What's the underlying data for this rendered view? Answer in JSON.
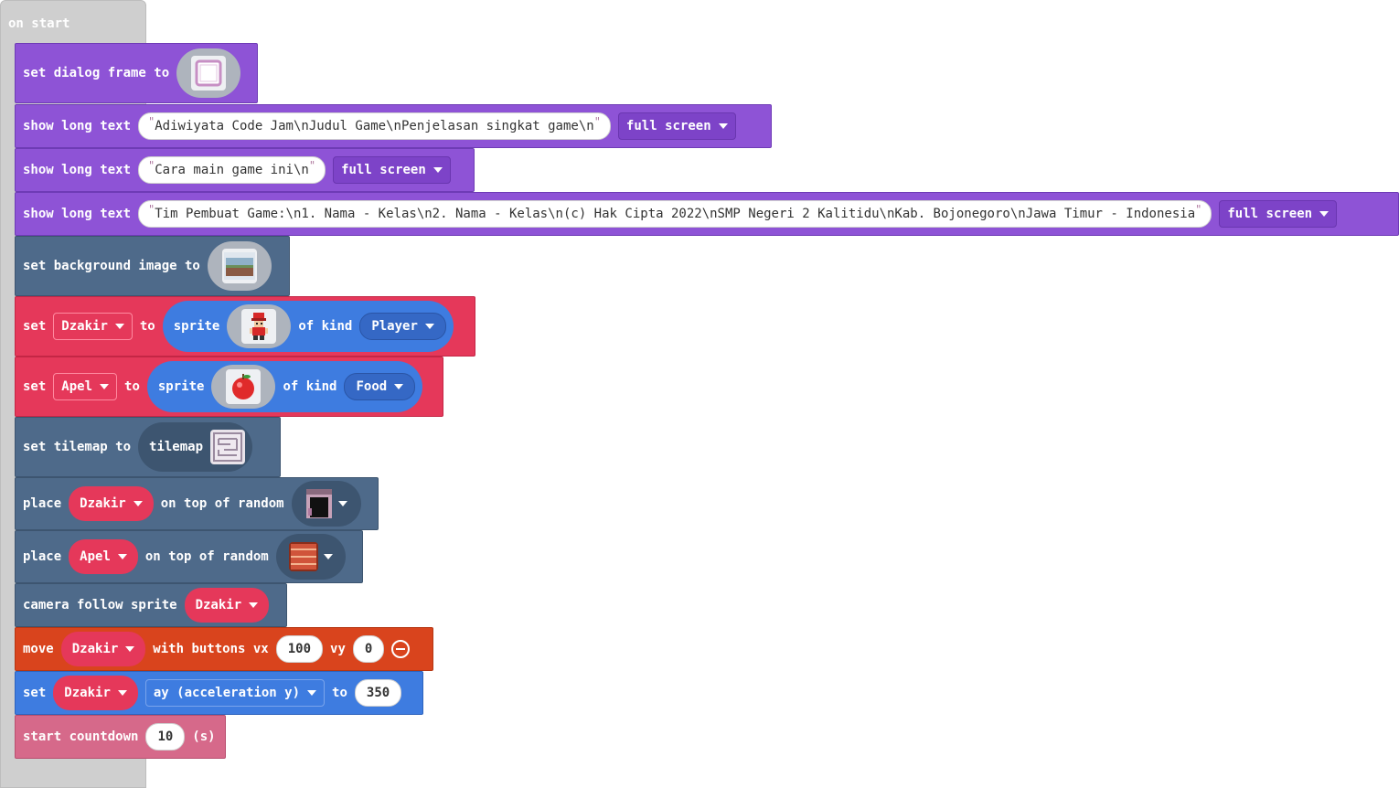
{
  "hat": {
    "label": "on start"
  },
  "blocks": {
    "dialog": {
      "set_label": "set dialog frame to",
      "image": "dialog-frame"
    },
    "text1": {
      "label": "show long text",
      "text": "Adiwiyata Code Jam\\nJudul Game\\nPenjelasan singkat game\\n",
      "mode": "full screen"
    },
    "text2": {
      "label": "show long text",
      "text": "Cara main game ini\\n",
      "mode": "full screen"
    },
    "text3": {
      "label": "show long text",
      "text": "Tim Pembuat Game:\\n1. Nama - Kelas\\n2. Nama - Kelas\\n(c) Hak Cipta 2022\\nSMP Negeri 2 Kalitidu\\nKab. Bojonegoro\\nJawa Timur - Indonesia",
      "mode": "full screen"
    },
    "bg": {
      "label": "set background image to",
      "image": "background-landscape"
    },
    "sprite1": {
      "set": "set",
      "var": "Dzakir",
      "to": "to",
      "sprite": "sprite",
      "of_kind": "of kind",
      "kind": "Player",
      "image": "player-character"
    },
    "sprite2": {
      "set": "set",
      "var": "Apel",
      "to": "to",
      "sprite": "sprite",
      "of_kind": "of kind",
      "kind": "Food",
      "image": "red-apple"
    },
    "tilemap": {
      "label": "set tilemap to",
      "inner": "tilemap",
      "image": "maze-tilemap"
    },
    "place1": {
      "place": "place",
      "var": "Dzakir",
      "rest": "on top of random",
      "tile": "dark-door-tile"
    },
    "place2": {
      "place": "place",
      "var": "Apel",
      "rest": "on top of random",
      "tile": "brick-tile"
    },
    "camera": {
      "label": "camera follow sprite",
      "var": "Dzakir"
    },
    "move": {
      "move": "move",
      "var": "Dzakir",
      "with": "with buttons vx",
      "vx": "100",
      "vy_label": "vy",
      "vy": "0"
    },
    "accel": {
      "set": "set",
      "var": "Dzakir",
      "prop": "ay (acceleration y)",
      "to": "to",
      "value": "350"
    },
    "countdown": {
      "label": "start countdown",
      "value": "10",
      "unit": "(s)"
    }
  },
  "colors": {
    "sprites": "#8e53d6",
    "scene": "#4e6a8a",
    "variables": "#e5385a",
    "controller": "#d9441d",
    "physics": "#3e7ce0",
    "info": "#d6698a"
  }
}
